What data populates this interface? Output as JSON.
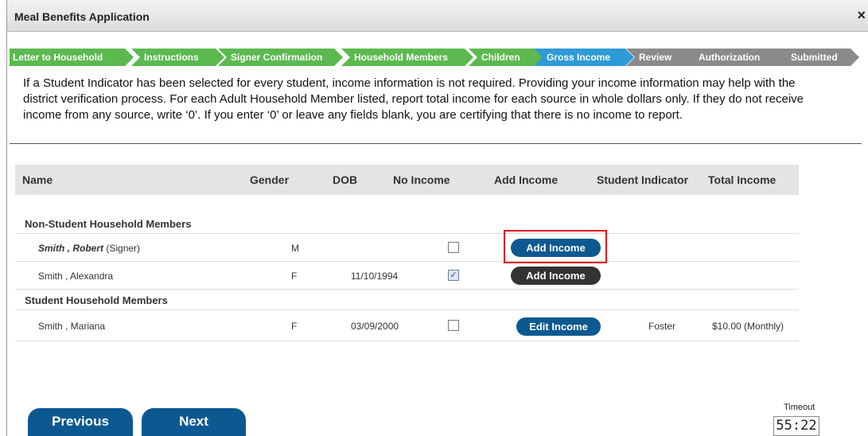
{
  "window": {
    "title": "Meal Benefits Application",
    "close_symbol": "×"
  },
  "steps": [
    {
      "label": "Letter to Household",
      "state": "done"
    },
    {
      "label": "Instructions",
      "state": "done"
    },
    {
      "label": "Signer Confirmation",
      "state": "done"
    },
    {
      "label": "Household Members",
      "state": "done"
    },
    {
      "label": "Children",
      "state": "done"
    },
    {
      "label": "Gross Income",
      "state": "current"
    },
    {
      "label": "Review",
      "state": "todo"
    },
    {
      "label": "Authorization",
      "state": "todo"
    },
    {
      "label": "Submitted",
      "state": "todo"
    }
  ],
  "instructions": "If a Student Indicator has been selected for every student, income information is not required. Providing your income information may help with the district verification process. For each Adult Household Member listed, report total income for each source in whole dollars only. If they do not receive income from any source, write ‘0’. If you enter ‘0’ or leave any fields blank, you are certifying that there is no income to report.",
  "table": {
    "headers": {
      "name": "Name",
      "gender": "Gender",
      "dob": "DOB",
      "no_income": "No Income",
      "add_income": "Add Income",
      "student_indicator": "Student Indicator",
      "total_income": "Total Income"
    },
    "groups": {
      "non_student": "Non-Student Household Members",
      "student": "Student Household Members"
    },
    "rows": [
      {
        "name": "Smith , Robert",
        "suffix": " (Signer)",
        "gender": "M",
        "dob": "",
        "no_income": false,
        "button": "Add Income",
        "student_indicator": "",
        "total_income": ""
      },
      {
        "name": "Smith , Alexandra",
        "suffix": "",
        "gender": "F",
        "dob": "11/10/1994",
        "no_income": true,
        "button": "Add Income",
        "student_indicator": "",
        "total_income": ""
      },
      {
        "name": "Smith , Mariana",
        "suffix": "",
        "gender": "F",
        "dob": "03/09/2000",
        "no_income": false,
        "button": "Edit Income",
        "student_indicator": "Foster",
        "total_income": "$10.00 (Monthly)"
      }
    ]
  },
  "nav": {
    "previous": "Previous",
    "next": "Next"
  },
  "timeout": {
    "label": "Timeout",
    "value": "55:22"
  },
  "colors": {
    "done": "#5bb94f",
    "current": "#2e9ad6",
    "todo": "#8a8a8a",
    "button_blue": "#0c5991",
    "button_dark": "#333333",
    "highlight": "#e0161b"
  }
}
